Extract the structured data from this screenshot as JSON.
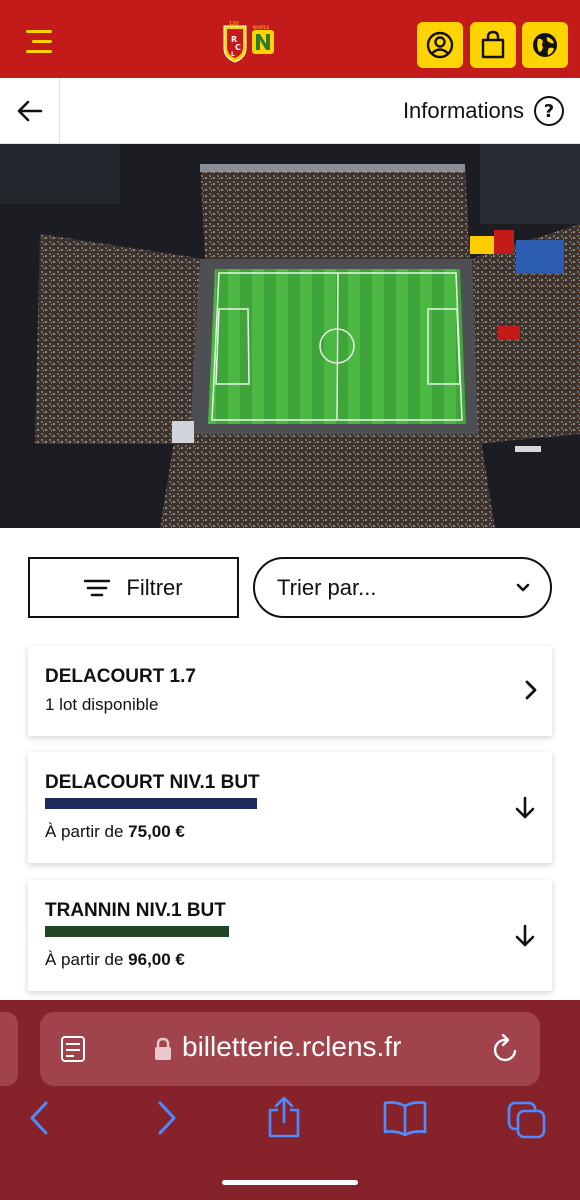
{
  "header": {
    "menu_icon": "hamburger-menu-icon",
    "logo": "rc-lens-vs-fc-nantes-logos",
    "logo_badge": "120",
    "logo_nantes": "NANTES",
    "logo_letters": [
      "R",
      "C",
      "L"
    ],
    "buttons": [
      "account-icon",
      "shopping-bag-icon",
      "globe-icon"
    ]
  },
  "subheader": {
    "back_icon": "arrow-left-icon",
    "info_label": "Informations",
    "help_icon": "question-circle-icon"
  },
  "filters": {
    "filter_label": "Filtrer",
    "sort_placeholder": "Trier par..."
  },
  "sections": [
    {
      "title": "DELACOURT 1.7",
      "subtitle": "1 lot disponible"
    },
    {
      "title": "DELACOURT NIV.1 BUT",
      "price_prefix": "À partir de",
      "price": "75,00 €",
      "color": "#1f2a5c"
    },
    {
      "title": "TRANNIN NIV.1 BUT",
      "price_prefix": "À partir de",
      "price": "96,00 €",
      "color": "#1e4624"
    }
  ],
  "browser": {
    "url": "billetterie.rclens.fr"
  },
  "colors": {
    "brand_red": "#c31a1a",
    "brand_yellow": "#ffd400",
    "browser_bar": "#86232a",
    "ios_blue": "#4d8cff"
  }
}
